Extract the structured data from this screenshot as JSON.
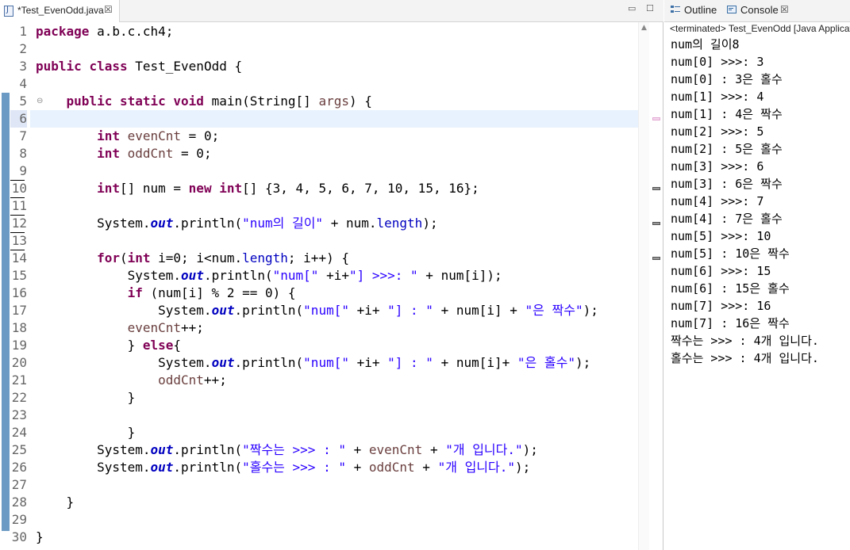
{
  "editor": {
    "tab_title": "*Test_EvenOdd.java",
    "tab_close": "☒",
    "minimize": "▭",
    "maximize": "☐",
    "line_numbers": [
      "1",
      "2",
      "3",
      "4",
      "5",
      "6",
      "7",
      "8",
      "9",
      "10",
      "11",
      "12",
      "13",
      "14",
      "15",
      "16",
      "17",
      "18",
      "19",
      "20",
      "21",
      "22",
      "23",
      "24",
      "25",
      "26",
      "27",
      "28",
      "29",
      "30"
    ],
    "fold_marker": "⊖",
    "code": {
      "l1_kw": "package",
      "l1_rest": " a.b.c.ch4;",
      "l3_kw1": "public",
      "l3_kw2": "class",
      "l3_rest": " Test_EvenOdd {",
      "l5_kw1": "public",
      "l5_kw2": "static",
      "l5_kw3": "void",
      "l5_rest": " main(String[] ",
      "l5_var": "args",
      "l5_end": ") {",
      "l7_kw": "int",
      "l7_var": "evenCnt",
      "l7_rest": " = 0;",
      "l8_kw": "int",
      "l8_var": "oddCnt",
      "l8_rest": " = 0;",
      "l10_kw1": "int",
      "l10_mid": "[] num = ",
      "l10_kw2": "new",
      "l10_sp": " ",
      "l10_kw3": "int",
      "l10_rest": "[] {3, 4, 5, 6, 7, 10, 15, 16};",
      "l12_a": "System.",
      "l12_out": "out",
      "l12_b": ".println(",
      "l12_str": "\"num의 길이\"",
      "l12_c": " + num.",
      "l12_len": "length",
      "l12_d": ");",
      "l14_kw1": "for",
      "l14_a": "(",
      "l14_kw2": "int",
      "l14_b": " i=0; i<num.",
      "l14_len": "length",
      "l14_c": "; i++) {",
      "l15_a": "System.",
      "l15_out": "out",
      "l15_b": ".println(",
      "l15_s1": "\"num[\"",
      "l15_c": " +i+",
      "l15_s2": "\"] >>>: \"",
      "l15_d": " + num[i]);",
      "l16_kw": "if",
      "l16_rest": " (num[i] % 2 == 0) {",
      "l17_a": "System.",
      "l17_out": "out",
      "l17_b": ".println(",
      "l17_s1": "\"num[\"",
      "l17_c": " +i+ ",
      "l17_s2": "\"] : \"",
      "l17_d": " + num[i] + ",
      "l17_s3": "\"은 짝수\"",
      "l17_e": ");",
      "l18_var": "evenCnt",
      "l18_rest": "++;",
      "l19_a": "} ",
      "l19_kw": "else",
      "l19_b": "{",
      "l20_a": "System.",
      "l20_out": "out",
      "l20_b": ".println(",
      "l20_s1": "\"num[\"",
      "l20_c": " +i+ ",
      "l20_s2": "\"] : \"",
      "l20_d": " + num[i]+ ",
      "l20_s3": "\"은 홀수\"",
      "l20_e": ");",
      "l21_var": "oddCnt",
      "l21_rest": "++;",
      "l22": "}",
      "l24": "}",
      "l25_a": "System.",
      "l25_out": "out",
      "l25_b": ".println(",
      "l25_s1": "\"짝수는 >>> : \"",
      "l25_c": " + ",
      "l25_var": "evenCnt",
      "l25_d": " + ",
      "l25_s2": "\"개 입니다.\"",
      "l25_e": ");",
      "l26_a": "System.",
      "l26_out": "out",
      "l26_b": ".println(",
      "l26_s1": "\"홀수는 >>> : \"",
      "l26_c": " + ",
      "l26_var": "oddCnt",
      "l26_d": " + ",
      "l26_s2": "\"개 입니다.\"",
      "l26_e": ");",
      "l28": "}",
      "l30": "}"
    },
    "scroll_up": "▲"
  },
  "right_panel": {
    "outline_tab": "Outline",
    "console_tab": "Console",
    "console_close": "☒",
    "status": "<terminated> Test_EvenOdd [Java Applicat",
    "output": [
      "num의 길이8",
      "num[0] >>>: 3",
      "num[0] : 3은 홀수",
      "num[1] >>>: 4",
      "num[1] : 4은 짝수",
      "num[2] >>>: 5",
      "num[2] : 5은 홀수",
      "num[3] >>>: 6",
      "num[3] : 6은 짝수",
      "num[4] >>>: 7",
      "num[4] : 7은 홀수",
      "num[5] >>>: 10",
      "num[5] : 10은 짝수",
      "num[6] >>>: 15",
      "num[6] : 15은 홀수",
      "num[7] >>>: 16",
      "num[7] : 16은 짝수",
      "짝수는 >>> : 4개 입니다.",
      "홀수는 >>> : 4개 입니다."
    ]
  },
  "colors": {
    "keyword": "#7f0055",
    "string": "#2a00ff",
    "field": "#0000c0",
    "local_var": "#6a3e3e",
    "current_line": "#e8f2fe",
    "change_bar": "#6b9ac4"
  }
}
